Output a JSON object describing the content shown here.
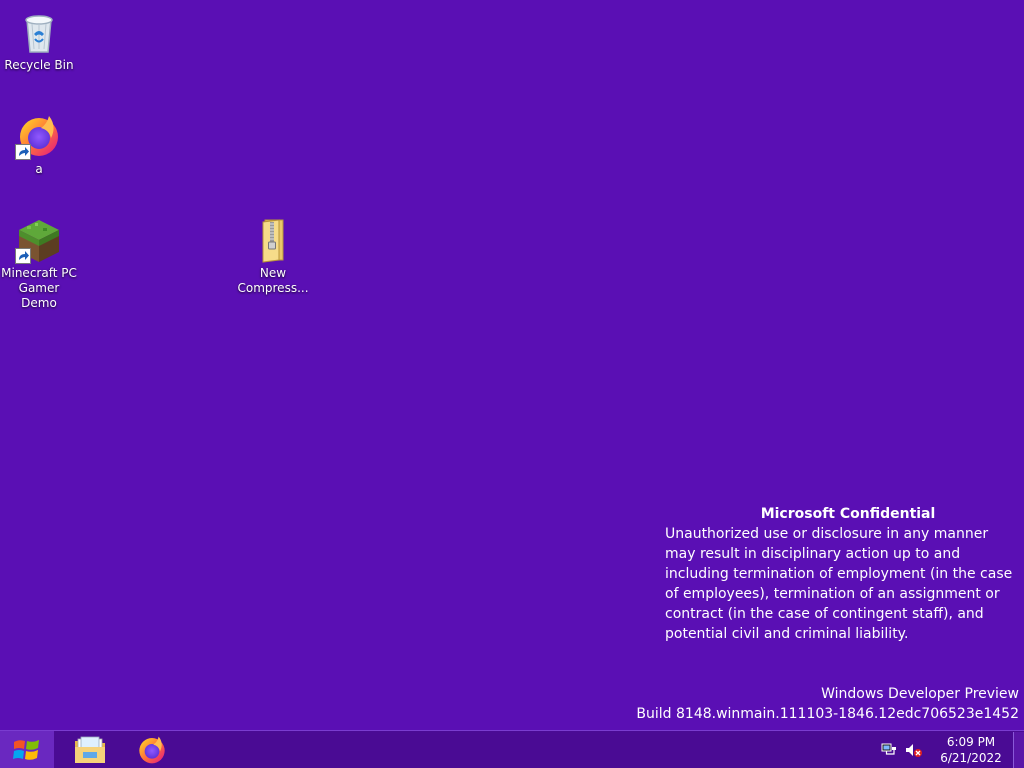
{
  "desktop": {
    "background_color": "#5a0fb4",
    "icons": [
      {
        "label": "Recycle Bin",
        "icon": "recycle-bin-icon"
      },
      {
        "label": "a",
        "icon": "firefox-icon"
      },
      {
        "label": "Minecraft PC Gamer Demo",
        "icon": "minecraft-grass-block-icon"
      },
      {
        "label": "New Compress...",
        "icon": "zip-folder-icon"
      }
    ]
  },
  "watermark": {
    "title": "Microsoft Confidential",
    "body": "Unauthorized use or disclosure in any manner may result in disciplinary action up to and including termination of employment (in the case of employees), termination of an assignment or contract (in the case of contingent staff), and potential civil and criminal liability.",
    "product": "Windows Developer Preview",
    "build": "Build 8148.winmain.111103-1846.12edc706523e1452"
  },
  "taskbar": {
    "start_icon": "windows-logo-icon",
    "pinned": [
      {
        "name": "File Explorer",
        "icon": "file-explorer-icon"
      },
      {
        "name": "Firefox",
        "icon": "firefox-icon"
      }
    ],
    "tray": {
      "network_icon": "network-icon",
      "volume_icon": "volume-muted-icon",
      "time": "6:09 PM",
      "date": "6/21/2022"
    }
  }
}
